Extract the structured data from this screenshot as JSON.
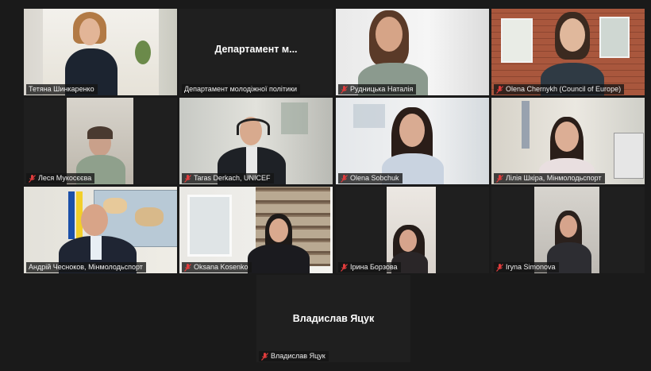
{
  "participants": [
    {
      "name": "Тетяна Шинкаренко",
      "muted": false,
      "video": true
    },
    {
      "name": "Департамент молодіжної політики",
      "center_name": "Департамент  м...",
      "muted": false,
      "video": false
    },
    {
      "name": "Рудницька Наталія",
      "muted": true,
      "video": true
    },
    {
      "name": "Olena Chernykh (Council of Europe)",
      "muted": true,
      "video": true
    },
    {
      "name": "Леся Мукосєєва",
      "muted": true,
      "video": true
    },
    {
      "name": "Taras Derkach, UNICEF",
      "muted": true,
      "video": true
    },
    {
      "name": "Olena Sobchuk",
      "muted": true,
      "video": true
    },
    {
      "name": "Лілія Шкіра, Мінмолодьспорт",
      "muted": true,
      "video": true
    },
    {
      "name": "Андрій Чесноков, Мінмолодьспорт",
      "muted": false,
      "video": true,
      "speaking": true
    },
    {
      "name": "Oksana Kosenko",
      "muted": true,
      "video": true
    },
    {
      "name": "Ірина Борзова",
      "muted": true,
      "video": true
    },
    {
      "name": "Iryna Simonova",
      "muted": true,
      "video": true
    },
    {
      "name": "Владислав Яцук",
      "center_name": "Владислав Яцук",
      "muted": true,
      "video": false
    }
  ],
  "colors": {
    "background": "#1a1a1a",
    "tile": "#222222",
    "muted_icon": "#e03c3c",
    "speaking_border": "#e2e27a"
  }
}
